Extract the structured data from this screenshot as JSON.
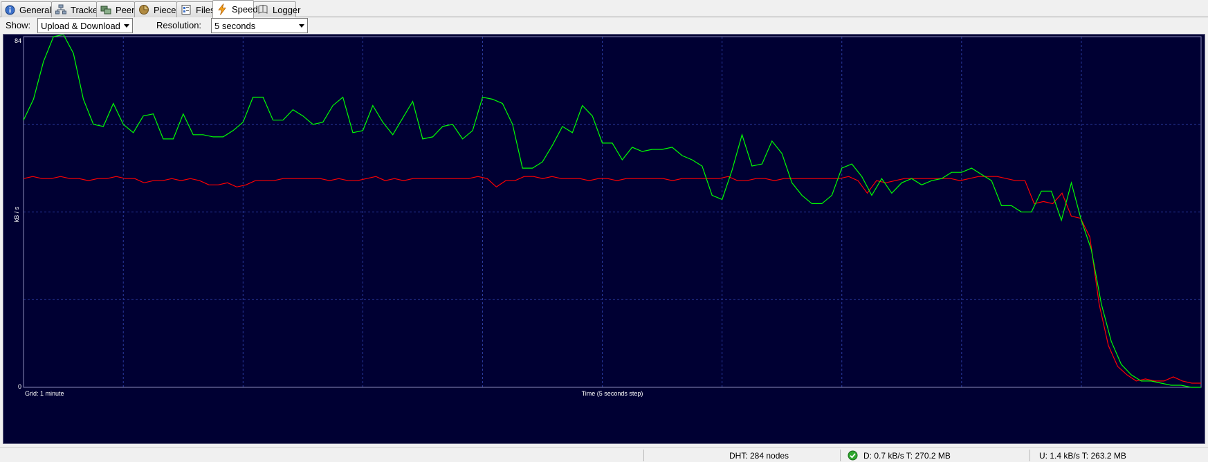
{
  "tabs": [
    {
      "label": "General",
      "icon": "info-icon",
      "active": false
    },
    {
      "label": "Trackers",
      "icon": "network-icon",
      "active": false
    },
    {
      "label": "Peers",
      "icon": "peers-icon",
      "active": false
    },
    {
      "label": "Pieces",
      "icon": "pieces-icon",
      "active": false
    },
    {
      "label": "Files",
      "icon": "files-icon",
      "active": false
    },
    {
      "label": "Speed",
      "icon": "lightning-icon",
      "active": true
    },
    {
      "label": "Logger",
      "icon": "logger-icon",
      "active": false
    }
  ],
  "toolbar": {
    "show_label": "Show:",
    "show_value": "Upload & Download",
    "resolution_label": "Resolution:",
    "resolution_value": "5 seconds"
  },
  "colors": {
    "background": "#000033",
    "grid": "#2a3aa0",
    "download": "#00ff00",
    "upload": "#ff0000",
    "axis_text": "#ffffff"
  },
  "chart_data": {
    "type": "line",
    "ylabel": "kB / s",
    "ymax_label": "84",
    "ymin_label": "0",
    "ylim": [
      0,
      84
    ],
    "grid_label": "Grid: 1 minute",
    "xlabel": "Time (5 seconds step)",
    "x_step_seconds": 5,
    "series": [
      {
        "role": "download",
        "values": [
          64,
          69,
          78,
          84,
          84.5,
          80,
          69,
          63,
          62.5,
          68,
          63,
          61,
          65,
          65.5,
          59.5,
          59.5,
          65.5,
          60.5,
          60.5,
          60,
          60,
          61.5,
          63.5,
          69.5,
          69.5,
          64,
          64,
          66.5,
          65,
          63,
          63.5,
          67.5,
          69.5,
          61,
          61.5,
          67.5,
          63.5,
          60.5,
          64.5,
          68.5,
          59.5,
          60,
          62.5,
          63,
          59.5,
          61.5,
          69.5,
          69,
          68,
          63,
          52.5,
          52.5,
          54,
          58,
          62.5,
          61,
          67.5,
          65,
          58.5,
          58.5,
          54.5,
          57.5,
          56.5,
          57,
          57,
          57.5,
          55.5,
          54.5,
          53,
          46,
          45,
          52,
          60.5,
          53,
          53.5,
          59,
          56,
          49,
          46,
          44,
          44,
          46,
          52.5,
          53.5,
          50.5,
          46,
          50,
          46.5,
          49,
          50,
          48.5,
          49.5,
          50,
          51.5,
          51.5,
          52.5,
          51,
          49.5,
          43.5,
          43.5,
          42,
          42,
          47,
          47,
          40,
          49,
          40,
          33,
          20,
          11,
          5.5,
          3,
          1.5,
          1.5,
          1,
          0.5,
          0.5,
          0,
          0
        ]
      },
      {
        "role": "upload",
        "values": [
          50,
          50.5,
          50,
          50,
          50.5,
          50,
          50,
          49.5,
          50,
          50,
          50.5,
          50,
          50,
          49,
          49.5,
          49.5,
          50,
          49.5,
          50,
          49.5,
          48.5,
          48.5,
          49,
          48,
          48.5,
          49.5,
          49.5,
          49.5,
          50,
          50,
          50,
          50,
          50,
          49.5,
          50,
          49.5,
          49.5,
          50,
          50.5,
          49.5,
          50,
          49.5,
          50,
          50,
          50,
          50,
          50,
          50,
          50,
          50.5,
          50,
          48,
          49.5,
          49.5,
          50.5,
          50.5,
          50,
          50.5,
          50,
          50,
          50,
          49.5,
          50,
          50,
          49.5,
          50,
          50,
          50,
          50,
          50,
          49.5,
          50,
          50,
          50,
          50,
          50,
          50.5,
          49.5,
          49.5,
          50,
          50,
          49.5,
          50,
          50,
          50,
          50,
          50,
          50,
          50,
          50.5,
          49.5,
          46.5,
          49.5,
          49,
          49.5,
          50,
          50,
          50,
          50,
          50,
          50,
          49.5,
          50,
          50.5,
          50.5,
          50.5,
          50,
          49.5,
          49.5,
          44,
          44.5,
          44,
          46.5,
          41,
          40.5,
          36,
          20,
          10,
          5,
          3,
          1.5,
          2,
          1.5,
          1.5,
          2.5,
          1.5,
          1,
          1
        ]
      }
    ]
  },
  "status": {
    "dht": "DHT: 284 nodes",
    "download": "D: 0.7 kB/s T: 270.2 MB",
    "upload": "U: 1.4 kB/s T: 263.2 MB"
  }
}
